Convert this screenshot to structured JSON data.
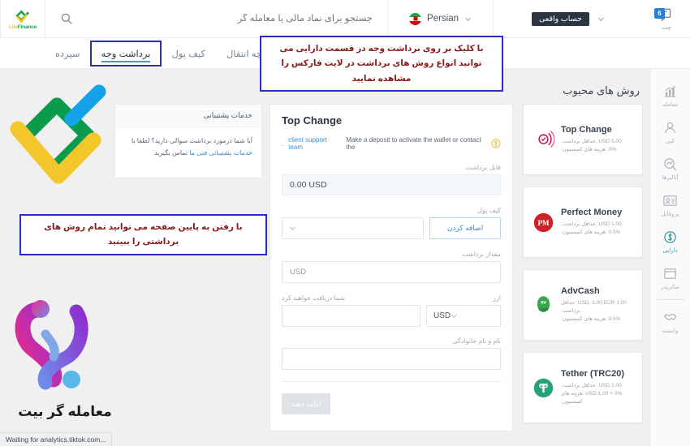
{
  "header": {
    "logo": {
      "name": "LiteFinance",
      "part1": "Lite",
      "part2": "Finance"
    },
    "search": {
      "placeholder": "جستجو برای نماد مالی یا معامله گر",
      "value": ""
    },
    "language": {
      "label": "Persian",
      "flag": "iran-flag"
    },
    "account": {
      "tooltip": "حساب واقعی"
    },
    "chat": {
      "label": "چت",
      "badge": "6"
    }
  },
  "tabs": [
    {
      "label": "سپرده",
      "active": false,
      "boxed": false
    },
    {
      "label": "برداشت وجه",
      "active": true,
      "boxed": true
    },
    {
      "label": "کیف پول",
      "active": false,
      "boxed": false
    },
    {
      "label": "تاریخچه انتقال",
      "active": false,
      "boxed": false
    }
  ],
  "sidebar": {
    "items": [
      {
        "label": "معامله",
        "icon": "chart-bars-icon",
        "active": false
      },
      {
        "label": "کپی",
        "icon": "person-copy-icon",
        "active": false
      },
      {
        "label": "آنالیزها",
        "icon": "analytics-search-icon",
        "active": false
      },
      {
        "label": "پروفایل",
        "icon": "id-card-icon",
        "active": false
      },
      {
        "label": "دارایی",
        "icon": "dollar-coin-icon",
        "active": true
      },
      {
        "label": "متاتریدر",
        "icon": "window-icon",
        "active": false
      },
      {
        "label": "وابسته",
        "icon": "handshake-icon",
        "active": false
      }
    ]
  },
  "main": {
    "popular_title": "روش های محبوب",
    "methods": [
      {
        "name": "Top Change",
        "min_label": "حداقل برداشت:",
        "min_value": "5.00 USD",
        "fee_label": "هزینه های کمیسیون:",
        "fee_value": "0%",
        "icon": "topchange-icon",
        "color": "#c2185b"
      },
      {
        "name": "Perfect Money",
        "min_label": "حداقل برداشت:",
        "min_value": "1.00 USD",
        "fee_label": "هزینه های کمیسیون:",
        "fee_value": "0.5%",
        "icon": "perfectmoney-icon",
        "color": "#cc2128"
      },
      {
        "name": "AdvCash",
        "min_label": "حداقل برداشت:",
        "min_value": "1.00 USD, 1.00 EUR",
        "fee_label": "هزینه های کمیسیون:",
        "fee_value": "0.5%",
        "icon": "advcash-icon",
        "color": "#35a94a"
      },
      {
        "name": "Tether (TRC20)",
        "min_label": "حداقل برداشت:",
        "min_value": "2.00 USD",
        "fee_label": "هزینه های کمیسیون:",
        "fee_value": "0% + 1.00 USD",
        "icon": "tether-icon",
        "color": "#26a17b"
      }
    ],
    "form": {
      "title": "Top Change",
      "notice_before": "Make a deposit to activate the wallet or contact the",
      "notice_link": "client support team",
      "notice_after": ".",
      "warn_icon": "warning-circle-icon",
      "available_label": "قابل برداشت",
      "available_value": "0.00 USD",
      "wallet_label": "کیف پول",
      "wallet_value": "",
      "add_button": "اضافه کردن",
      "amount_label": "مقدار برداشت",
      "amount_value": "USD",
      "receive_label": "شما دریافت خواهید کرد",
      "currency_label": "ارز",
      "currency_value": "USD",
      "receive_value": "",
      "name_label": "نام و نام خانوادگی",
      "name_value": "",
      "submit_label": "ادامه دهید"
    },
    "support": {
      "title": "خدمات پشتیبانی",
      "text_1": "آیا شما درمورد برداشت سوالی دارید؟ لطفا با",
      "link": "خدمات پشتیبانی فنی ما",
      "text_2": "تماس بگیرید"
    }
  },
  "annotations": [
    {
      "text": "با کلیک بر روی برداشت وجه در قسمت دارایی می توانید انواع روش های برداشت در لایت فارکس را مشاهده نمایید"
    },
    {
      "text": "با رفتن به پایین صفحه می توانید تمام روش های برداشتی را ببینید"
    }
  ],
  "branding": {
    "lite_logo": "litefinance-mark",
    "mg_logo": "moamelegar-bit-mark",
    "mg_text": "معامله گر بیت"
  },
  "statusbar": {
    "text": "Waiting for analytics.tiktok.com..."
  }
}
